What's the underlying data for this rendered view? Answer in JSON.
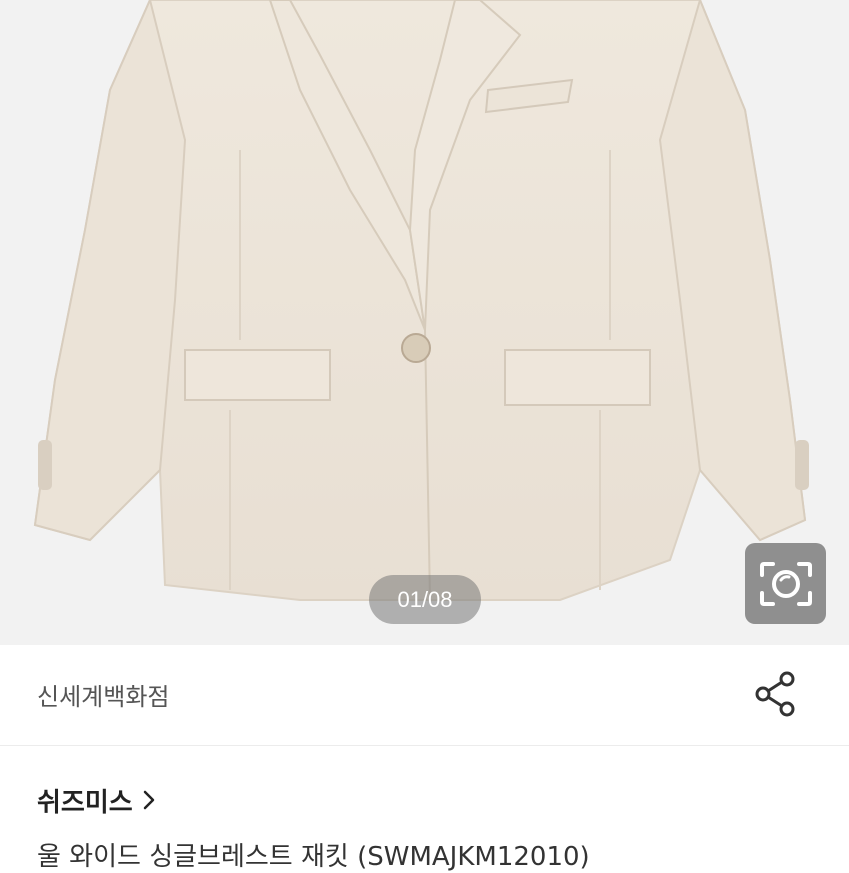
{
  "gallery": {
    "counter": "01/08",
    "image_alt": "product-photo-jacket"
  },
  "store": {
    "name": "신세계백화점"
  },
  "brand": {
    "name": "쉬즈미스"
  },
  "product": {
    "title": "울 와이드 싱글브레스트 재킷 (SWMAJKM12010)"
  },
  "icons": {
    "lens": "camera-search-icon",
    "share": "share-icon",
    "chevron": "chevron-right-icon"
  },
  "colors": {
    "jacket": "#ece4d9",
    "counter_bg": "#8a8a8a",
    "text_dark": "#222222"
  }
}
